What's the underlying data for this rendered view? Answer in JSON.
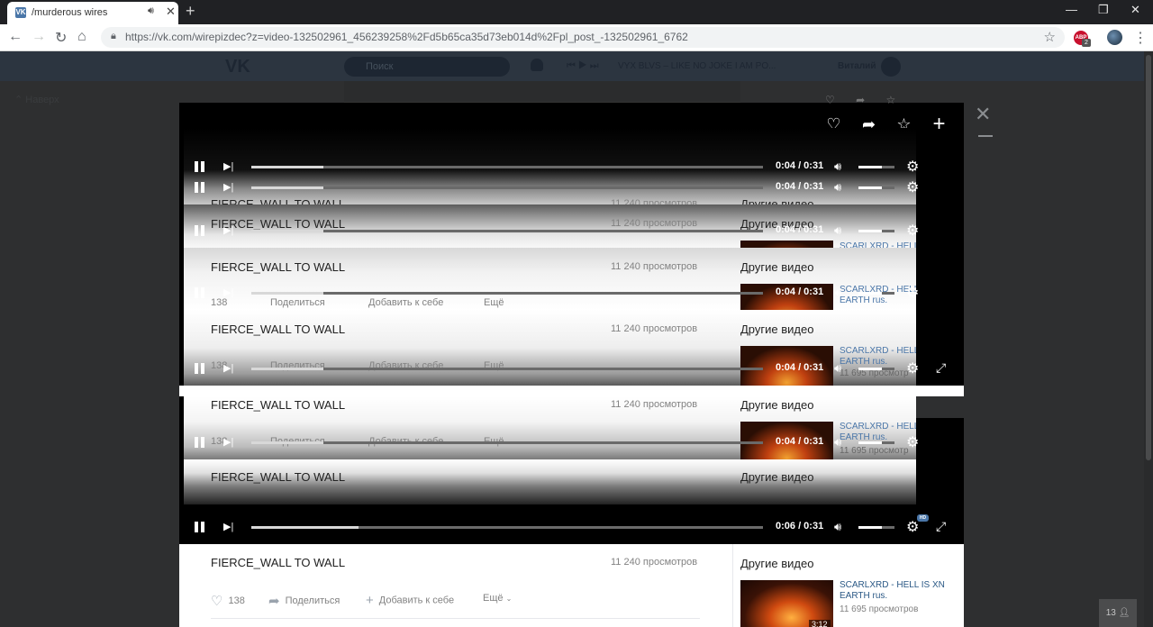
{
  "browser": {
    "tab_title": "/murderous wires",
    "favicon": "VK",
    "url": "https://vk.com/wirepizdec?z=video-132502961_456239258%2Fd5b65ca35d73eb014d%2Fpl_post_-132502961_6762",
    "extension_badge": "2",
    "extension_label": "ABP"
  },
  "vk": {
    "search_placeholder": "Поиск",
    "now_playing": "VYX BLVS – LIKE NO JOKE I AM PO...",
    "user_name": "Виталий",
    "back_to_top": "Наверх",
    "chat_count": "13"
  },
  "video": {
    "title": "FIERCE_WALL TO WALL",
    "views": "11 240 просмотров",
    "likes": "138",
    "share_label": "Поделиться",
    "add_label": "Добавить к себе",
    "more_label": "Ещё",
    "other_videos_label": "Другие видео",
    "time_main": "0:06 / 0:31",
    "time_glitch": "0:04 / 0:31",
    "time_ghost": "0:04 / 0:31",
    "progress_main": 0.21,
    "progress_glitch": 0.14,
    "volume": 0.65,
    "hd_label": "HD"
  },
  "related": {
    "title": "SCARLXRD - HELL IS XN EARTH rus.",
    "title_line1": "SCARLXRD - HELL IS XN",
    "title_line2": "EARTH rus.",
    "title_cut": "SCARLXRD - HELL",
    "title_cut2": "EARTH rus.",
    "views": "11 695 просмотров",
    "views_cut": "11 695 просмотр",
    "duration": "3:12"
  }
}
